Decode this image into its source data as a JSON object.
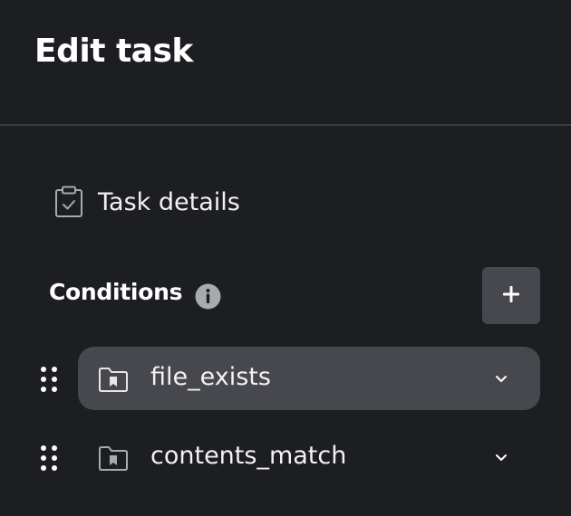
{
  "page": {
    "title": "Edit task"
  },
  "task_details": {
    "label": "Task details",
    "icon": "clipboard-check-icon"
  },
  "conditions": {
    "label": "Conditions",
    "info_icon": "info-icon",
    "add_icon": "plus-icon",
    "items": [
      {
        "name": "file_exists",
        "icon": "folder-bookmark-icon",
        "expanded": false,
        "highlighted": true
      },
      {
        "name": "contents_match",
        "icon": "folder-bookmark-icon",
        "expanded": false,
        "highlighted": false
      }
    ]
  },
  "colors": {
    "background": "#1d1e22",
    "divider": "#3a3b40",
    "pill_active": "#47484e",
    "button_bg": "#47484e",
    "text": "#f2f2f3",
    "icon_muted": "#a9aaae"
  }
}
